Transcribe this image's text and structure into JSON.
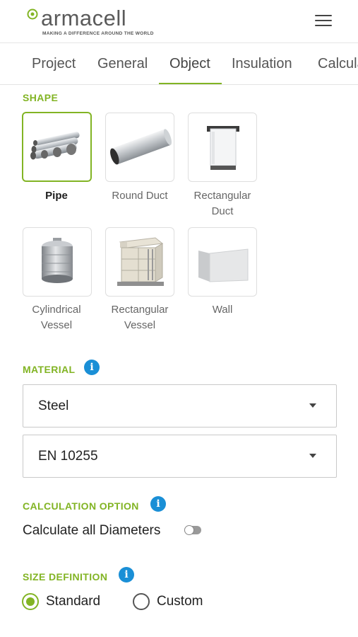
{
  "header": {
    "logo_text": "armacell",
    "tagline": "MAKING A DIFFERENCE AROUND THE WORLD"
  },
  "tabs": [
    {
      "label": "Project"
    },
    {
      "label": "General"
    },
    {
      "label": "Object"
    },
    {
      "label": "Insulation"
    },
    {
      "label": "Calcula"
    }
  ],
  "active_tab": "Object",
  "shape": {
    "label": "SHAPE",
    "items": [
      {
        "label": "Pipe",
        "selected": true,
        "icon": "pipe-icon"
      },
      {
        "label": "Round Duct",
        "selected": false,
        "icon": "round-duct-icon"
      },
      {
        "label": "Rectangular\nDuct",
        "selected": false,
        "icon": "rectangular-duct-icon"
      },
      {
        "label": "Cylindrical\nVessel",
        "selected": false,
        "icon": "cylindrical-vessel-icon"
      },
      {
        "label": "Rectangular\nVessel",
        "selected": false,
        "icon": "rectangular-vessel-icon"
      },
      {
        "label": "Wall",
        "selected": false,
        "icon": "wall-icon"
      }
    ]
  },
  "material": {
    "label": "MATERIAL",
    "selected_material": "Steel",
    "selected_standard": "EN 10255"
  },
  "calculation_option": {
    "label": "CALCULATION OPTION",
    "toggle_label": "Calculate all Diameters",
    "toggle_on": false
  },
  "size_definition": {
    "label": "SIZE DEFINITION",
    "options": [
      {
        "label": "Standard",
        "checked": true
      },
      {
        "label": "Custom",
        "checked": false
      }
    ]
  },
  "colors": {
    "accent": "#82b424",
    "info": "#1a8fd6"
  }
}
